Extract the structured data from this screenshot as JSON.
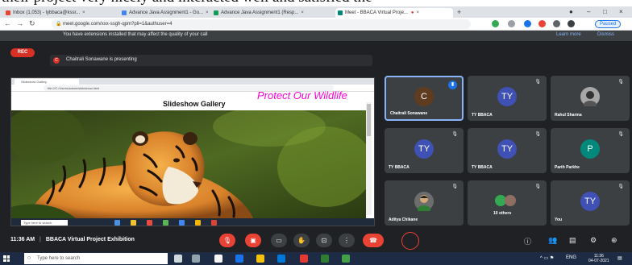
{
  "caption": {
    "text": "their project very nicely and interacted well and satisfied the"
  },
  "browser": {
    "tabs": [
      {
        "label": "Inbox (1,053) - lybbaca@kssr..."
      },
      {
        "label": "Advance Java Assignment1 - Go..."
      },
      {
        "label": "Advance Java Assignment1 (Resp..."
      },
      {
        "label": "Meet - BBACA Virtual Proje..."
      }
    ],
    "new_tab": "+",
    "url": "meet.google.com/xxx-ssgh-qpm?pli=1&authuser=4",
    "profile_label": "Paused"
  },
  "meet": {
    "extension_warning": "You have extensions installed that may affect the quality of your call",
    "learn_more": "Learn more",
    "dismiss": "Dismiss",
    "rec_label": "REC",
    "presenting_initial": "C",
    "presenting_text": "Chaitrali Sonawane is presenting",
    "shared": {
      "tab_label": "Slideshow Gallery",
      "url": "file:///C:/Users/admin/slideshow.html",
      "wildlife_title": "Protect Our Wildlife",
      "gallery_title": "Slideshow Gallery",
      "search_text": "Type here to search"
    },
    "participants": [
      {
        "name": "Chaitrali Sonawane",
        "initial": "C",
        "color": "#5f3c1f"
      },
      {
        "name": "TY BBACA",
        "initial": "TY",
        "color": "#3f51b5"
      },
      {
        "name": "Rahul Sharma",
        "initial": "",
        "color": ""
      },
      {
        "name": "TY BBACA",
        "initial": "TY",
        "color": "#3f51b5"
      },
      {
        "name": "TY BBACA",
        "initial": "TY",
        "color": "#3f51b5"
      },
      {
        "name": "Parth Parkhe",
        "initial": "P",
        "color": "#00897b"
      },
      {
        "name": "Aditya Chikane",
        "initial": "",
        "color": ""
      },
      {
        "name": "10 others",
        "initial": "",
        "color": ""
      },
      {
        "name": "You",
        "initial": "TY",
        "color": "#3f51b5"
      }
    ],
    "time": "11:36 AM",
    "separator": "|",
    "meeting_name": "BBACA Virtual Project Exhibition"
  },
  "taskbar": {
    "search_placeholder": "Type here to search",
    "tray_lang": "ENG",
    "clock_time": "11:36",
    "clock_date": "04-07-2021"
  }
}
